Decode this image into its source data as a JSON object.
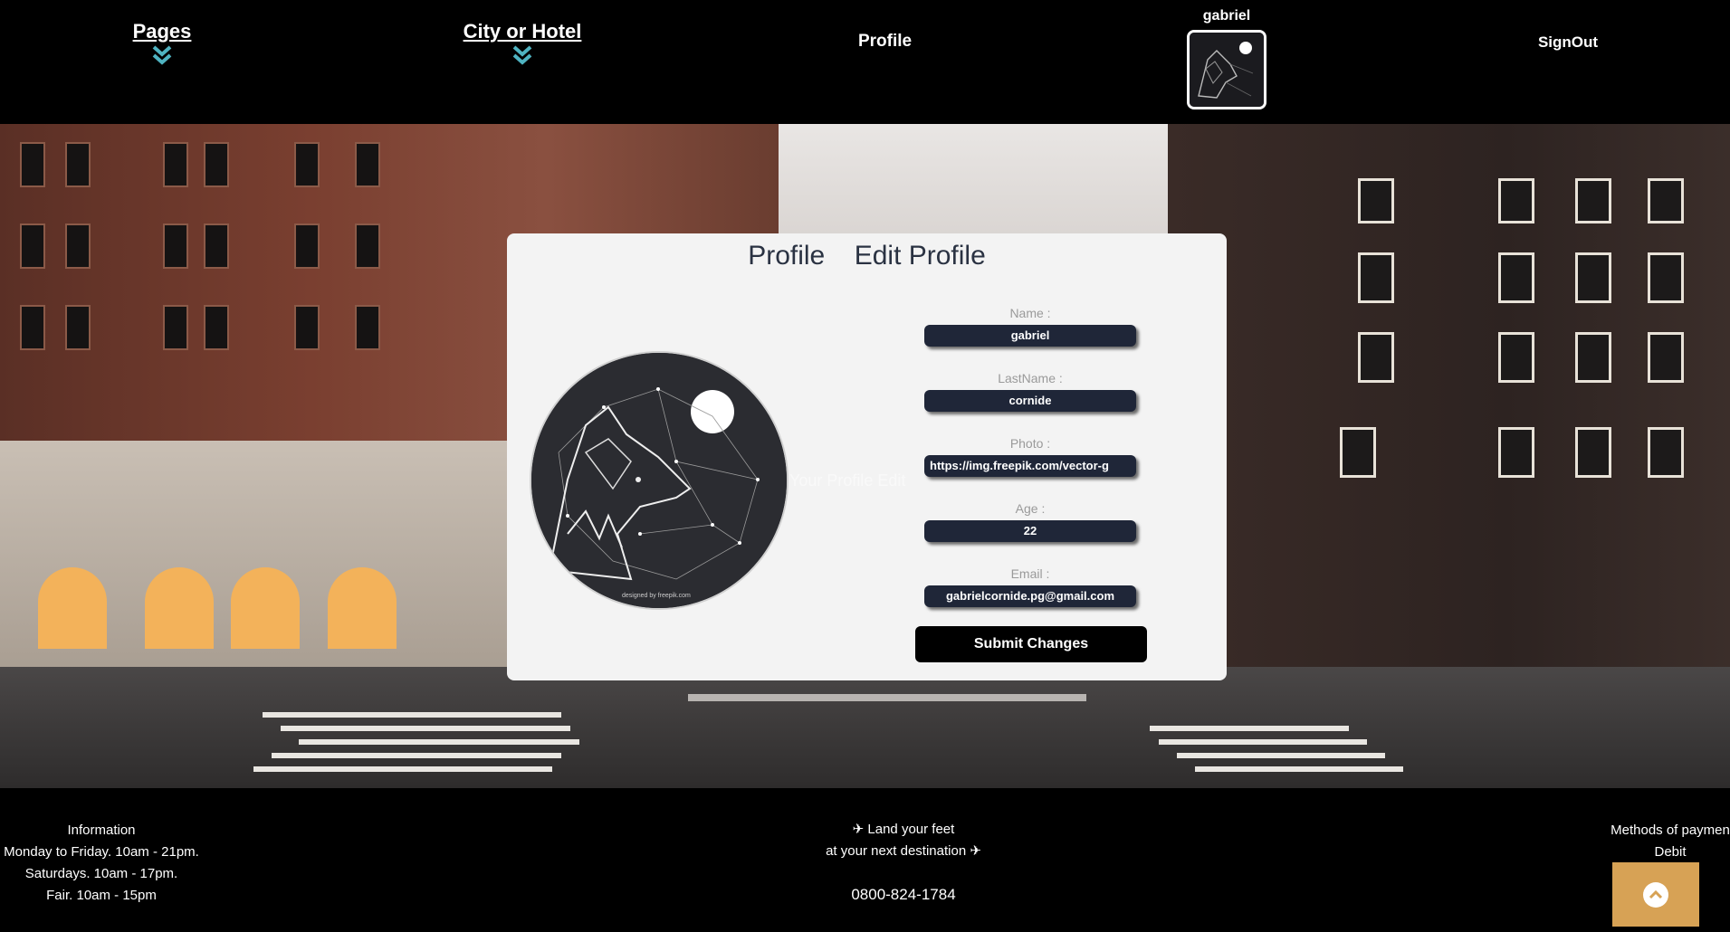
{
  "header": {
    "nav": {
      "pages": "Pages",
      "city_or_hotel": "City or Hotel",
      "profile": "Profile",
      "signout": "SignOut"
    },
    "user": {
      "name": "gabriel"
    }
  },
  "card": {
    "tabs": [
      "Profile",
      "Edit Profile"
    ],
    "overlay_text": "Your Profile Edit",
    "image_credit": "designed by freepik.com",
    "fields": [
      {
        "label": "Name :",
        "value": "gabriel"
      },
      {
        "label": "LastName :",
        "value": "cornide"
      },
      {
        "label": "Photo :",
        "value": "https://img.freepik.com/vector-g"
      },
      {
        "label": "Age :",
        "value": "22"
      },
      {
        "label": "Email :",
        "value": "gabrielcornide.pg@gmail.com"
      }
    ],
    "submit_label": "Submit Changes"
  },
  "footer": {
    "info": [
      "Information",
      "Monday to Friday. 10am - 21pm.",
      "Saturdays. 10am - 17pm.",
      "Fair. 10am - 15pm"
    ],
    "tagline": [
      "✈ Land your feet",
      "at your next destination ✈"
    ],
    "phone": "0800-824-1784",
    "payment": [
      "Methods of paymen",
      "Debit"
    ]
  },
  "colors": {
    "header_bg": "#000000",
    "card_bg": "#f3f3f3",
    "field_bg": "#1f2638",
    "accent_teal": "#4fb3c1",
    "scroll_top_bg": "#d7a255"
  },
  "icons": {
    "dropdown": "double-chevron-down-icon",
    "scroll_top": "chevron-up-icon"
  }
}
